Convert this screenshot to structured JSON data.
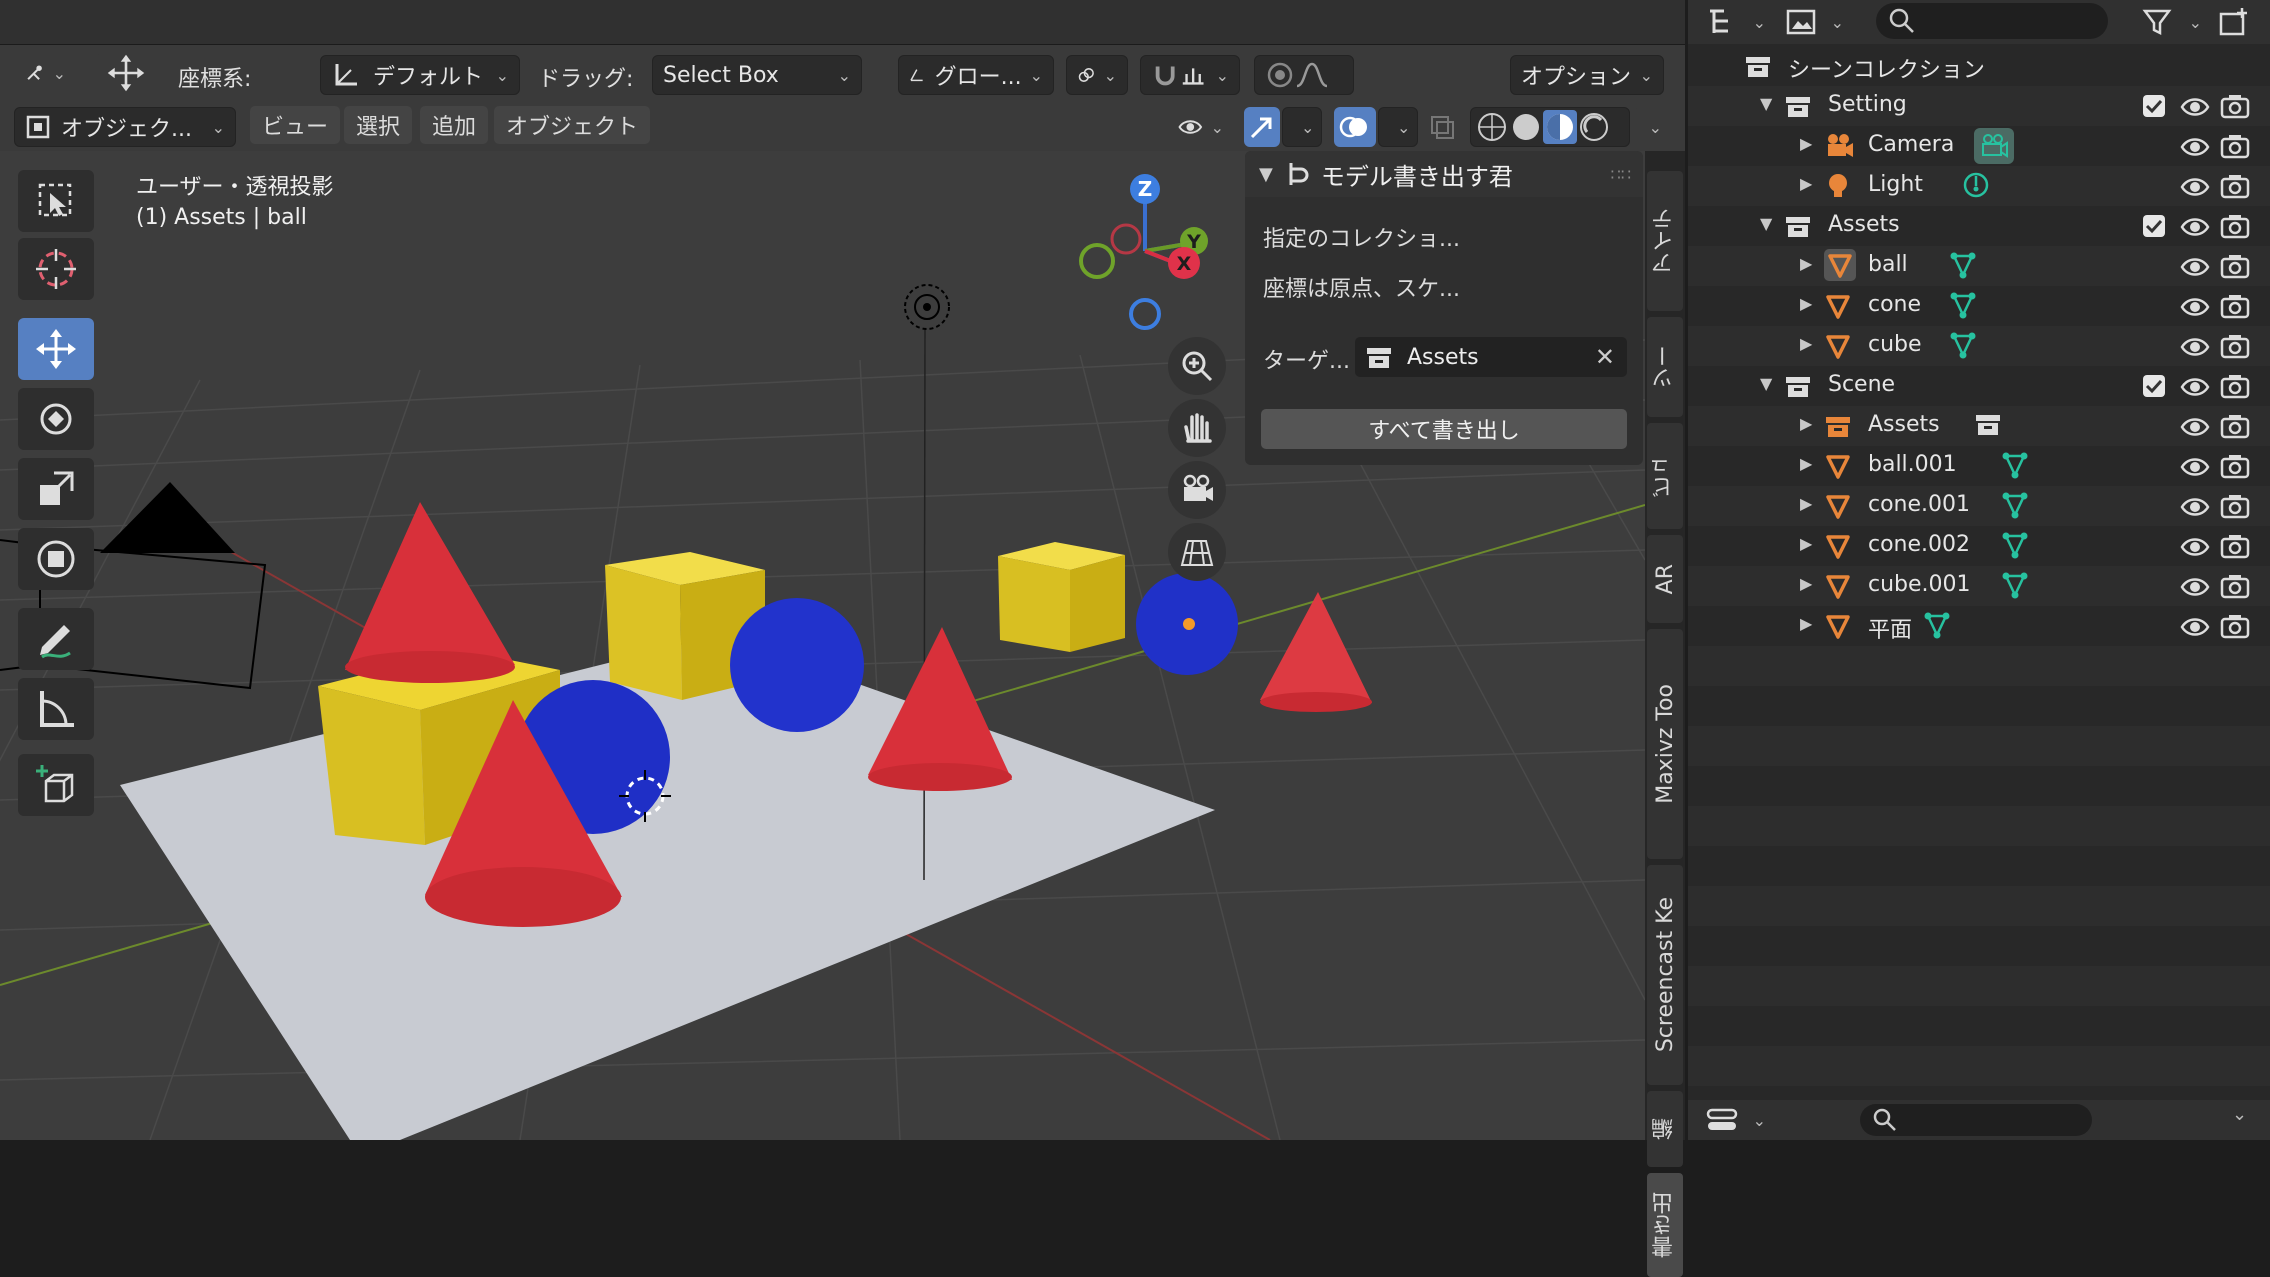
{
  "header": {
    "coord_label": "座標系:",
    "coord_value": "デフォルト",
    "drag_label": "ドラッグ:",
    "drag_value": "Select Box",
    "transform_value": "グロー...",
    "options_label": "オプション",
    "mode_value": "オブジェク...",
    "menus": [
      "ビュー",
      "選択",
      "追加",
      "オブジェクト"
    ]
  },
  "viewport": {
    "projection_label": "ユーザー・透視投影",
    "context_label": "(1) Assets | ball",
    "axes": {
      "z": "Z",
      "y": "Y",
      "x": "X"
    }
  },
  "npanel": {
    "title": "モデル書き出す君",
    "line1": "指定のコレクショ...",
    "line2": "座標は原点、スケ...",
    "target_label": "ターゲ...",
    "target_value": "Assets",
    "export_button": "すべて書き出し"
  },
  "side_tabs": [
    "アイテ",
    "ツー",
    "ビュ",
    "AR",
    "Maxivz Too",
    "Screencast Ke",
    "編",
    "書き出"
  ],
  "outliner": {
    "rows": [
      {
        "label": "シーンコレクション",
        "indent": 0,
        "icon": "scene-collection-icon",
        "arrow": "",
        "check": false,
        "vis": false,
        "extra": ""
      },
      {
        "label": "Setting",
        "indent": 1,
        "icon": "collection-icon",
        "arrow": "▼",
        "check": true,
        "vis": true,
        "extra": ""
      },
      {
        "label": "Camera",
        "indent": 2,
        "icon": "camera-icon",
        "arrow": "▶",
        "check": false,
        "vis": true,
        "extra": "camera-data-icon"
      },
      {
        "label": "Light",
        "indent": 2,
        "icon": "light-icon",
        "arrow": "▶",
        "check": false,
        "vis": true,
        "extra": "light-data-icon"
      },
      {
        "label": "Assets",
        "indent": 1,
        "icon": "collection-icon",
        "arrow": "▼",
        "check": true,
        "vis": true,
        "extra": ""
      },
      {
        "label": "ball",
        "indent": 2,
        "icon": "mesh-object-icon",
        "arrow": "▶",
        "check": false,
        "vis": true,
        "extra": "mesh-data-icon",
        "selected": true
      },
      {
        "label": "cone",
        "indent": 2,
        "icon": "mesh-object-icon",
        "arrow": "▶",
        "check": false,
        "vis": true,
        "extra": "mesh-data-icon"
      },
      {
        "label": "cube",
        "indent": 2,
        "icon": "mesh-object-icon",
        "arrow": "▶",
        "check": false,
        "vis": true,
        "extra": "mesh-data-icon"
      },
      {
        "label": "Scene",
        "indent": 1,
        "icon": "collection-icon",
        "arrow": "▼",
        "check": true,
        "vis": true,
        "extra": ""
      },
      {
        "label": "Assets",
        "indent": 2,
        "icon": "collection-instance-icon",
        "arrow": "▶",
        "check": false,
        "vis": true,
        "extra": "collection-icon"
      },
      {
        "label": "ball.001",
        "indent": 2,
        "icon": "mesh-object-icon",
        "arrow": "▶",
        "check": false,
        "vis": true,
        "extra": "mesh-data-icon"
      },
      {
        "label": "cone.001",
        "indent": 2,
        "icon": "mesh-object-icon",
        "arrow": "▶",
        "check": false,
        "vis": true,
        "extra": "mesh-data-icon"
      },
      {
        "label": "cone.002",
        "indent": 2,
        "icon": "mesh-object-icon",
        "arrow": "▶",
        "check": false,
        "vis": true,
        "extra": "mesh-data-icon"
      },
      {
        "label": "cube.001",
        "indent": 2,
        "icon": "mesh-object-icon",
        "arrow": "▶",
        "check": false,
        "vis": true,
        "extra": "mesh-data-icon"
      },
      {
        "label": "平面",
        "indent": 2,
        "icon": "mesh-object-icon",
        "arrow": "▶",
        "check": false,
        "vis": true,
        "extra": "mesh-data-icon"
      }
    ]
  },
  "colors": {
    "accent": "#5680c2",
    "object_orange": "#e8863a",
    "mesh_green": "#27c2a0",
    "cone_red": "#d8303a",
    "cube_yellow": "#e2c82a",
    "ball_blue": "#1c2fcf",
    "plane": "#c8cbd2"
  }
}
